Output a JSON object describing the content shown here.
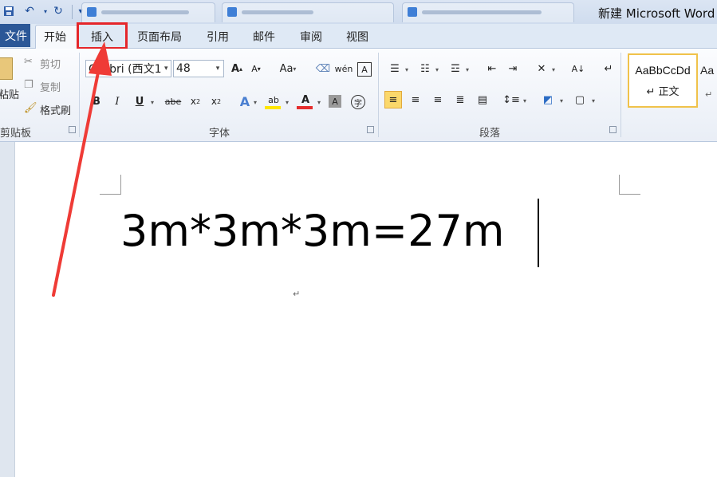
{
  "window": {
    "title": "新建 Microsoft Word"
  },
  "quick_access": [
    "save-icon",
    "undo-icon",
    "redo-icon",
    "customize-icon"
  ],
  "doc_tabs": [
    {
      "label": ""
    },
    {
      "label": ""
    },
    {
      "label": ""
    }
  ],
  "menu": {
    "file": "文件",
    "tabs": [
      "开始",
      "插入",
      "页面布局",
      "引用",
      "邮件",
      "审阅",
      "视图"
    ]
  },
  "clipboard": {
    "paste": "粘贴",
    "cut": "剪切",
    "copy": "复制",
    "format_painter": "格式刷",
    "group": "剪贴板"
  },
  "font": {
    "name": "Calibri (西文1",
    "size": "48",
    "group": "字体"
  },
  "paragraph": {
    "group": "段落"
  },
  "styles": {
    "sample": "AaBbCcDd",
    "normal": "正文",
    "sample2": "Aa"
  },
  "document": {
    "text": "3m*3m*3m=27m"
  },
  "colors": {
    "highlight_box": "#e5262a",
    "arrow": "#ef3b36",
    "file_tab": "#2b5797",
    "font_color": "#e52d2d",
    "highlight_yellow": "#ffe600"
  }
}
